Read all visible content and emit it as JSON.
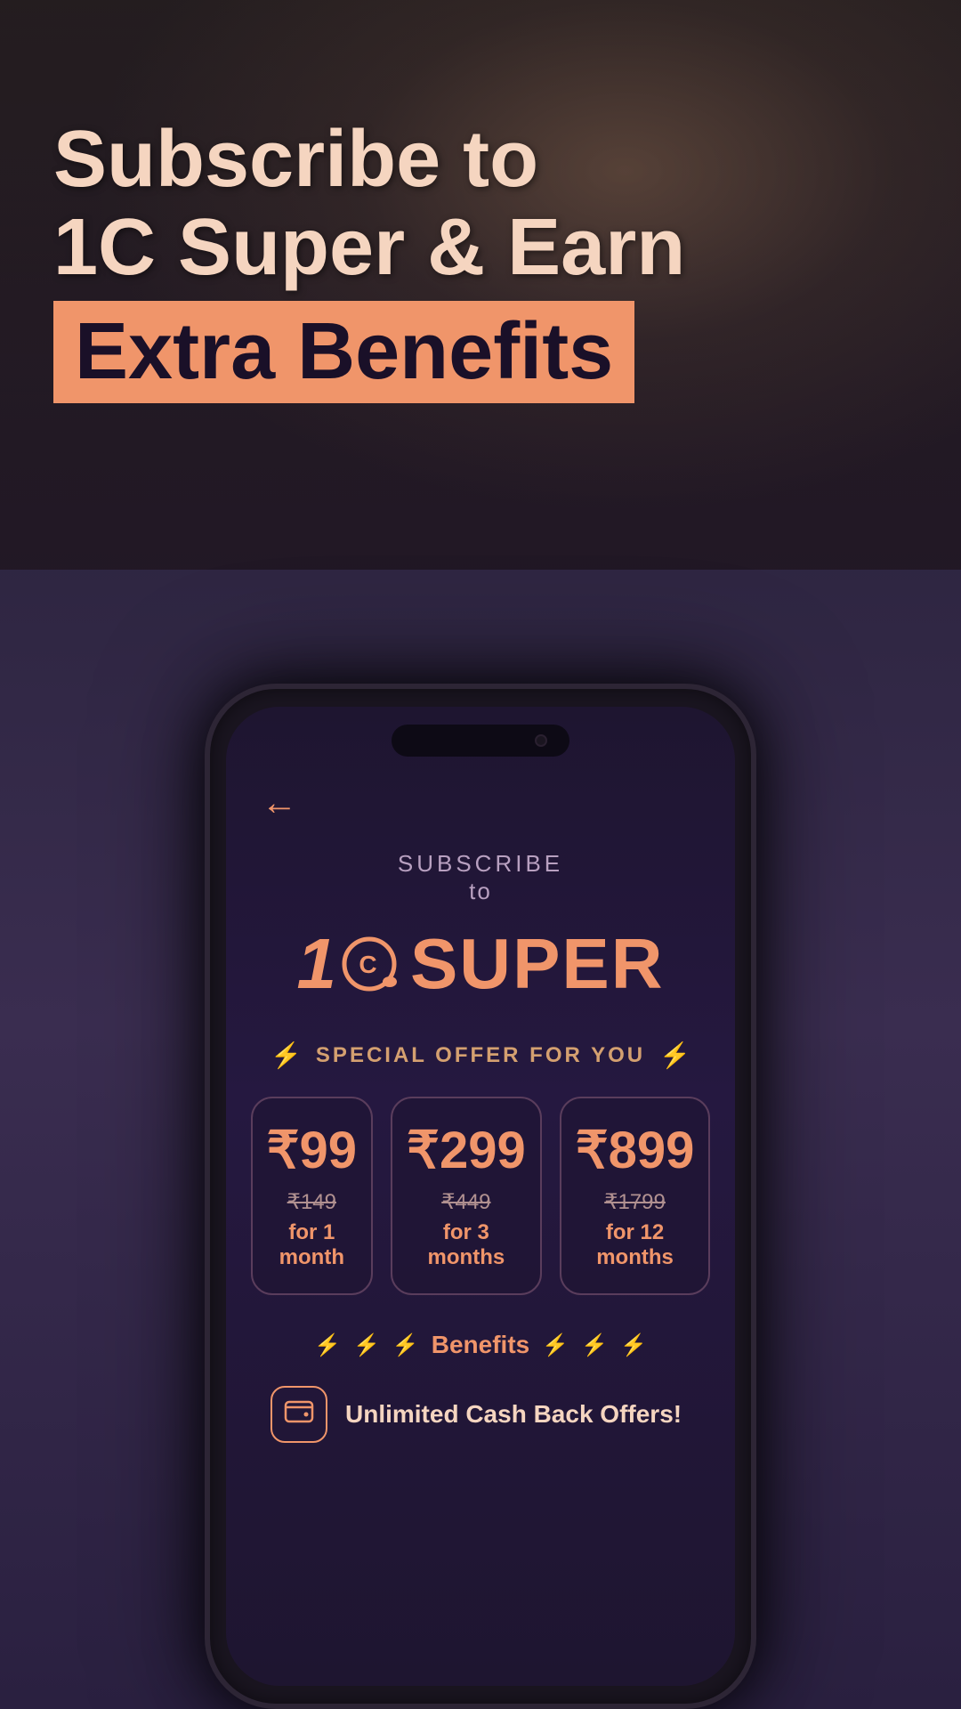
{
  "page": {
    "background_color": "#2a2040"
  },
  "header": {
    "line1": "Subscribe to",
    "line2": "1C Super & Earn",
    "highlight": "Extra Benefits"
  },
  "phone": {
    "back_label": "←",
    "subscribe_label": "SUBSCRIBE",
    "subscribe_to": "to",
    "brand": "1C SUPER",
    "special_offer_label": "SPECIAL OFFER FOR YOU",
    "plans": [
      {
        "price": "₹99",
        "original": "₹149",
        "duration": "for 1 month"
      },
      {
        "price": "₹299",
        "original": "₹449",
        "duration": "for 3 months"
      },
      {
        "price": "₹899",
        "original": "₹1799",
        "duration": "for 12 months"
      }
    ],
    "benefits_label": "Benefits",
    "benefit_item": {
      "icon": "💳",
      "text": "Unlimited Cash Back Offers!"
    }
  },
  "icons": {
    "back": "←",
    "lightning": "⚡",
    "lightning_dim": "⚡"
  }
}
